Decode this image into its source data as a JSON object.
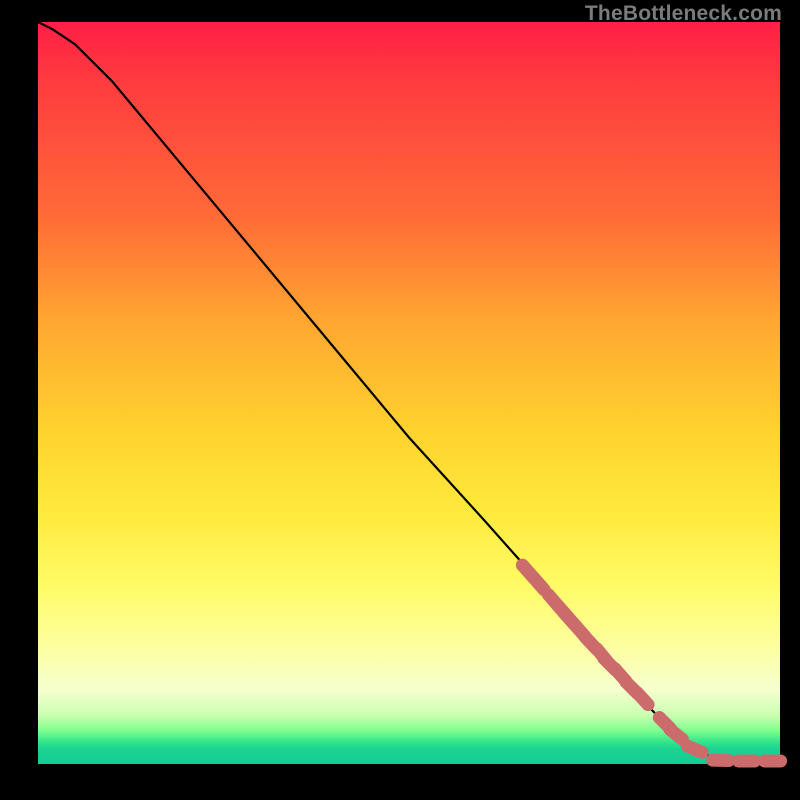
{
  "watermark": "TheBottleneck.com",
  "colors": {
    "background": "#000000",
    "curve_stroke": "#000000",
    "marker_fill": "#cc6b6b",
    "marker_stroke": "#cc6b6b"
  },
  "chart_data": {
    "type": "line",
    "title": "",
    "xlabel": "",
    "ylabel": "",
    "xlim": [
      0,
      100
    ],
    "ylim": [
      0,
      100
    ],
    "grid": false,
    "legend": false,
    "series": [
      {
        "name": "curve",
        "style": "line",
        "x": [
          0,
          2,
          5,
          10,
          20,
          30,
          40,
          50,
          60,
          68,
          78,
          84,
          88,
          90,
          92,
          94,
          96,
          98,
          100
        ],
        "y": [
          100,
          99,
          97,
          92,
          80,
          68,
          56,
          44,
          33,
          24,
          12,
          6,
          2,
          1.2,
          0.8,
          0.5,
          0.3,
          0.3,
          0.3
        ]
      },
      {
        "name": "markers",
        "style": "scatter",
        "x": [
          66.0,
          67.5,
          69.5,
          70.8,
          71.5,
          73.0,
          74.5,
          76.0,
          77.0,
          78.5,
          80.0,
          81.5,
          84.5,
          86.0,
          88.5,
          92.0,
          95.5,
          99.0
        ],
        "y": [
          26.0,
          24.3,
          22.0,
          20.5,
          19.7,
          18.0,
          16.3,
          14.7,
          13.5,
          12.0,
          10.3,
          8.8,
          5.5,
          4.0,
          2.0,
          0.5,
          0.4,
          0.4
        ]
      }
    ]
  }
}
